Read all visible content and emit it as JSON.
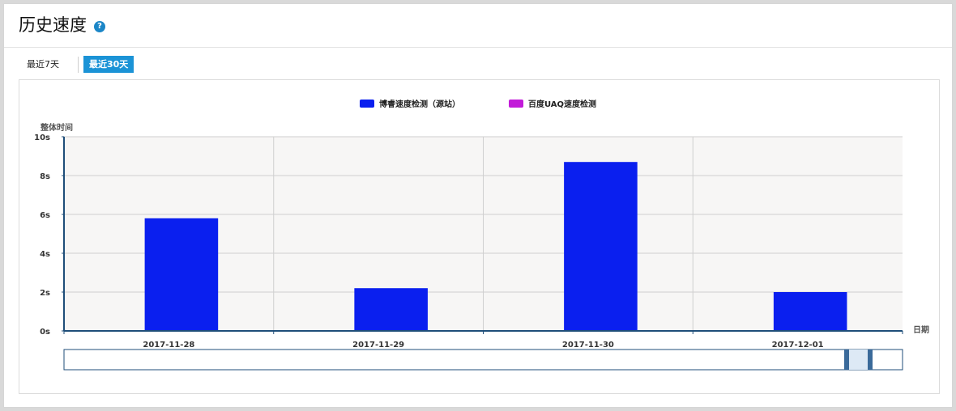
{
  "header": {
    "title": "历史速度",
    "help_icon": "?"
  },
  "tabs": [
    {
      "label": "最近7天",
      "active": false
    },
    {
      "label": "最近30天",
      "active": true
    }
  ],
  "colors": {
    "series_primary": "#0a1fef",
    "series_secondary": "#c21bd9",
    "accent": "#1b93d6",
    "axis": "#1f4e79"
  },
  "chart_data": {
    "type": "bar",
    "categories": [
      "2017-11-28",
      "2017-11-29",
      "2017-11-30",
      "2017-12-01"
    ],
    "series": [
      {
        "name": "博睿速度检测（源站）",
        "values": [
          5.8,
          2.2,
          8.7,
          2.0
        ]
      },
      {
        "name": "百度UAQ速度检测",
        "values": [
          0,
          0,
          0,
          0
        ]
      }
    ],
    "ylabel": "整体时间",
    "xlabel": "日期",
    "ylim": [
      0,
      10
    ],
    "yticks": [
      0,
      2,
      4,
      6,
      8,
      10
    ],
    "ytick_suffix": "s",
    "grid": true,
    "legend": "top-center"
  }
}
